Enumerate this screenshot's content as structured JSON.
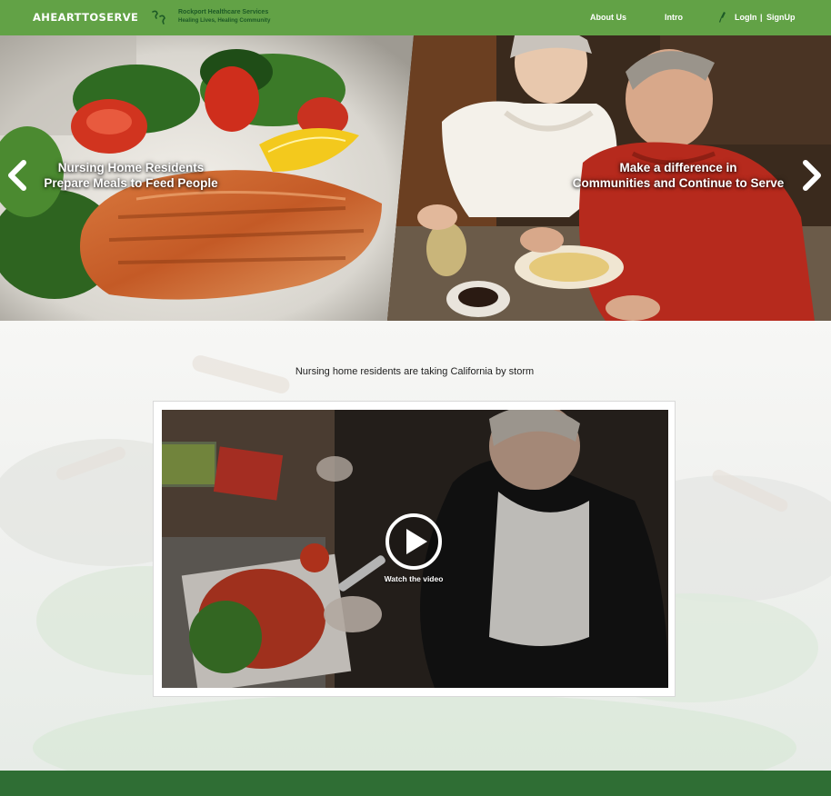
{
  "navbar": {
    "brand": "AHEARTTOSERVE",
    "partner_name": "Rockport Healthcare Services",
    "partner_tagline": "Healing Lives, Healing Community",
    "links": {
      "about": "About Us",
      "intro": "Intro",
      "login": "LogIn",
      "separator": "|",
      "signup": "SignUp"
    },
    "color": "#62a246"
  },
  "hero": {
    "slides": [
      {
        "caption_line1": "Nursing Home Residents",
        "caption_line2": "Prepare Meals to Feed People"
      },
      {
        "caption_line1": "Make a difference in",
        "caption_line2": "Communities and Continue to Serve"
      }
    ],
    "prev_icon": "chevron-left-icon",
    "next_icon": "chevron-right-icon"
  },
  "main": {
    "tagline": "Nursing home residents are taking California by storm",
    "video": {
      "watch_label": "Watch the video",
      "icon": "play-icon"
    }
  },
  "footer": {
    "color": "#2f6e34"
  }
}
